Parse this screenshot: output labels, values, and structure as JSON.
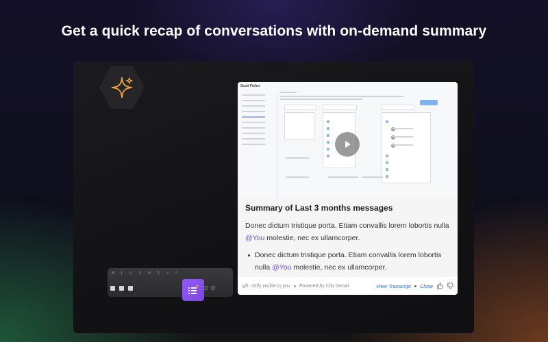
{
  "headline": "Get a quick recap of conversations with on-demand summary",
  "preview": {
    "app_title": "Scott Fisher",
    "play_icon": "play-icon"
  },
  "summary": {
    "title": "Summary of Last 3 months messages",
    "paragraph_text": "Donec dictum tristique porta. Etiam convallis lorem lobortis nulla",
    "paragraph_mention": "@You",
    "paragraph_tail": "molestie, nec  ex ullamcorper.",
    "bullets": [
      {
        "text": "Donec dictum tristique porta. Etiam convallis lorem lobortis nulla",
        "mention": "@You",
        "tail": "molestie, nec  ex ullamcorper."
      }
    ]
  },
  "footer": {
    "visibility": "Only visible to you",
    "powered_by": "Powered by Cliq GenAI",
    "view_transcript": "View Transcript",
    "close": "Close"
  },
  "colors": {
    "accent_purple": "#8f5cf5",
    "link_blue": "#2a6fd0",
    "sparkle_orange": "#f2a33a"
  }
}
